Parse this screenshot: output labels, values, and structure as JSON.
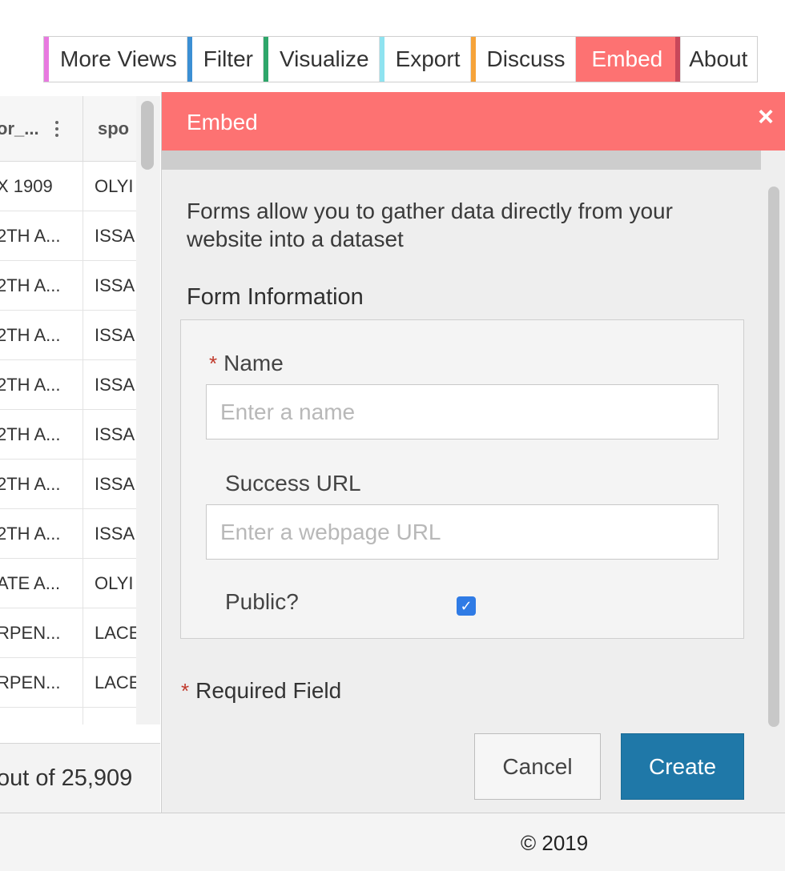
{
  "tabs": [
    {
      "label": "More Views",
      "color": "#e879e0",
      "active": false
    },
    {
      "label": "Filter",
      "color": "#3b8fd4",
      "active": false
    },
    {
      "label": "Visualize",
      "color": "#2ea66a",
      "active": false
    },
    {
      "label": "Export",
      "color": "#8fe3f0",
      "active": false
    },
    {
      "label": "Discuss",
      "color": "#f6a33a",
      "active": false
    },
    {
      "label": "Embed",
      "color": "#c9475a",
      "active": true,
      "bg": "#fd7272"
    },
    {
      "label": "About",
      "color": "#ffffff",
      "active": false
    }
  ],
  "grid": {
    "columns": [
      {
        "label": "or_..."
      },
      {
        "label": "spo"
      }
    ],
    "rows": [
      [
        "X 1909",
        "OLYI"
      ],
      [
        "2TH A...",
        "ISSA"
      ],
      [
        "2TH A...",
        "ISSA"
      ],
      [
        "2TH A...",
        "ISSA"
      ],
      [
        "2TH A...",
        "ISSA"
      ],
      [
        "2TH A...",
        "ISSA"
      ],
      [
        "2TH A...",
        "ISSA"
      ],
      [
        "2TH A...",
        "ISSA"
      ],
      [
        "ATE A...",
        "OLYI"
      ],
      [
        "RPEN...",
        "LACE"
      ],
      [
        "RPEN...",
        "LACE"
      ],
      [
        "",
        ""
      ]
    ],
    "count_text": "out of 25,909"
  },
  "panel": {
    "title": "Embed",
    "close_symbol": "×",
    "description": "Forms allow you to gather data directly from your website into a dataset",
    "section_title": "Form Information",
    "form": {
      "name_label": "Name",
      "name_placeholder": "Enter a name",
      "url_label": "Success URL",
      "url_placeholder": "Enter a webpage URL",
      "public_label": "Public?",
      "public_checked": true,
      "check_symbol": "✓",
      "required_star": "*"
    },
    "required_note": "Required Field",
    "cancel_label": "Cancel",
    "create_label": "Create"
  },
  "footer": {
    "copyright": "© 2019"
  },
  "colors": {
    "accent": "#fd7272",
    "primary_button": "#1f78a8",
    "checkbox": "#2f7be5"
  }
}
